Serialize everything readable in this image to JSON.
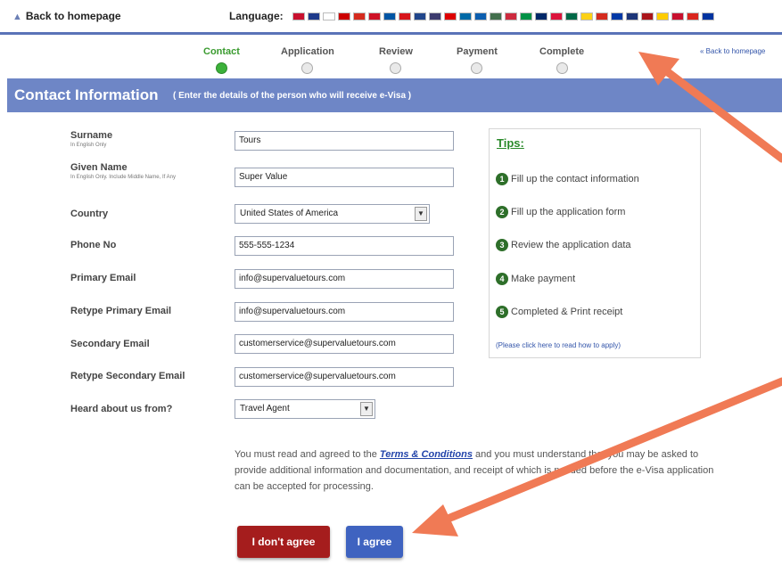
{
  "topbar": {
    "back_home": "Back to homepage",
    "home_icon": "home-icon",
    "language_label": "Language:",
    "flag_colors": [
      "#c8102e",
      "#1e3a8a",
      "#ffffff",
      "#cc0000",
      "#d52b1e",
      "#ce1126",
      "#0055a4",
      "#d7141a",
      "#21468b",
      "#3c3b6e",
      "#dd0000",
      "#006aa7",
      "#0d5eaf",
      "#436f4d",
      "#cd2a3e",
      "#009246",
      "#002868",
      "#dc143c",
      "#006847",
      "#fcd116",
      "#d52b1e",
      "#0039a6",
      "#1c3578",
      "#aa151b",
      "#fecc00",
      "#c8102e",
      "#da251d",
      "#0033a0"
    ]
  },
  "steps": [
    {
      "label": "Contact",
      "active": true
    },
    {
      "label": "Application",
      "active": false
    },
    {
      "label": "Review",
      "active": false
    },
    {
      "label": "Payment",
      "active": false
    },
    {
      "label": "Complete",
      "active": false
    }
  ],
  "back_link": "« Back to homepage",
  "header": {
    "title": "Contact Information",
    "subtitle": "( Enter the details of the person who will receive e-Visa )"
  },
  "form": {
    "surname": {
      "label": "Surname",
      "sub": "In English Only",
      "value": "Tours"
    },
    "given_name": {
      "label": "Given Name",
      "sub": "In English Only. Include Middle Name, If Any",
      "value": "Super Value"
    },
    "country": {
      "label": "Country",
      "value": "United States of America"
    },
    "phone": {
      "label": "Phone No",
      "value": "555-555-1234"
    },
    "primary_email": {
      "label": "Primary Email",
      "value": "info@supervaluetours.com"
    },
    "retype_primary_email": {
      "label": "Retype Primary Email",
      "value": "info@supervaluetours.com"
    },
    "secondary_email": {
      "label": "Secondary Email",
      "value": "customerservice@supervaluetours.com"
    },
    "retype_secondary_email": {
      "label": "Retype Secondary Email",
      "value": "customerservice@supervaluetours.com"
    },
    "heard_from": {
      "label": "Heard about us from?",
      "value": "Travel Agent"
    }
  },
  "tips": {
    "title": "Tips:",
    "items": [
      {
        "num": "1",
        "text": "Fill up the contact information"
      },
      {
        "num": "2",
        "text": "Fill up the application form"
      },
      {
        "num": "3",
        "text": "Review the application data"
      },
      {
        "num": "4",
        "text": "Make payment"
      },
      {
        "num": "5",
        "text": "Completed & Print receipt"
      }
    ],
    "howto": "(Please click here to read how to apply)"
  },
  "terms": {
    "before": "You must read and agreed to the ",
    "link": "Terms & Conditions",
    "after": " and you must understand that you may be asked to provide additional information and documentation, and receipt of which is needed before the e-Visa application can be accepted for processing."
  },
  "buttons": {
    "disagree": "I don't agree",
    "agree": "I agree"
  },
  "colors": {
    "header_band": "#6e86c6",
    "active_step": "#3cb13a",
    "disagree_button": "#a51d1d",
    "agree_button": "#3f63c0",
    "annotation_arrow": "#f07a55"
  }
}
